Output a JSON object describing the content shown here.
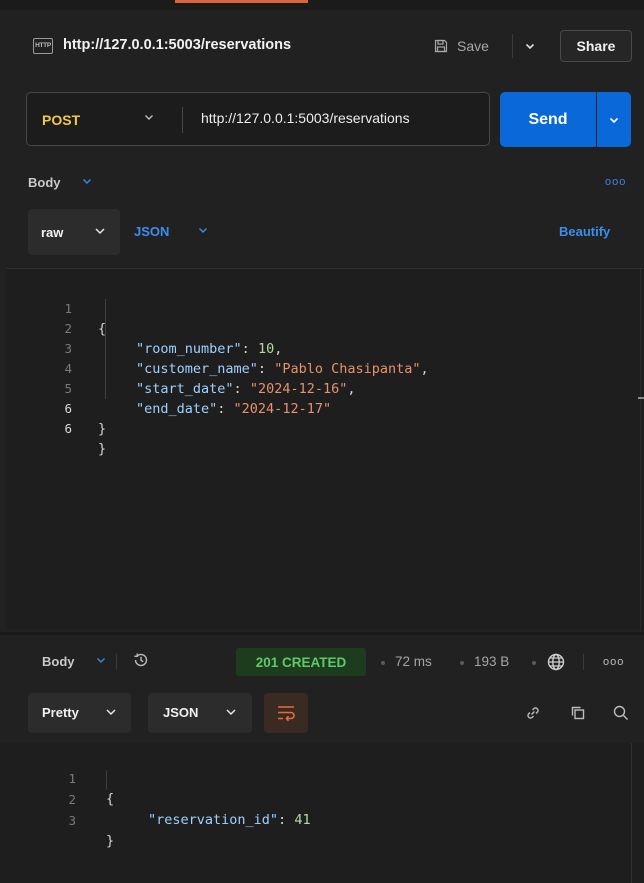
{
  "request": {
    "icon": "http-icon",
    "icon_text": "HTTP",
    "title": "http://127.0.0.1:5003/reservations",
    "save_label": "Save",
    "share_label": "Share",
    "method": "POST",
    "url": "http://127.0.0.1:5003/reservations",
    "send_label": "Send"
  },
  "request_body": {
    "tab_label": "Body",
    "mode": "raw",
    "language": "JSON",
    "beautify_label": "Beautify",
    "lines": [
      {
        "no": "1",
        "open": "{"
      },
      {
        "no": "2",
        "key": "\"room_number\"",
        "sep": ": ",
        "num": "10",
        "end": ","
      },
      {
        "no": "3",
        "key": "\"customer_name\"",
        "sep": ": ",
        "str": "\"Pablo Chasipanta\"",
        "end": ","
      },
      {
        "no": "4",
        "key": "\"start_date\"",
        "sep": ": ",
        "str": "\"2024-12-16\"",
        "end": ","
      },
      {
        "no": "5",
        "key": "\"end_date\"",
        "sep": ": ",
        "str": "\"2024-12-17\"",
        "end": ""
      },
      {
        "no": "6",
        "close": "}"
      }
    ]
  },
  "response": {
    "tab_label": "Body",
    "status": "201 CREATED",
    "time": "72 ms",
    "size": "193 B",
    "format": "Pretty",
    "language": "JSON",
    "lines": [
      {
        "no": "1",
        "open": "{"
      },
      {
        "no": "2",
        "key": "\"reservation_id\"",
        "sep": ": ",
        "num": "41",
        "end": ""
      },
      {
        "no": "3",
        "close": "}"
      }
    ]
  },
  "colors": {
    "background": "#212121",
    "accent_orange": "#d9653b",
    "send_blue": "#0a68d9",
    "method_yellow": "#f3c74a",
    "status_green": "#5ec96b",
    "link_blue": "#3b8ef0"
  }
}
